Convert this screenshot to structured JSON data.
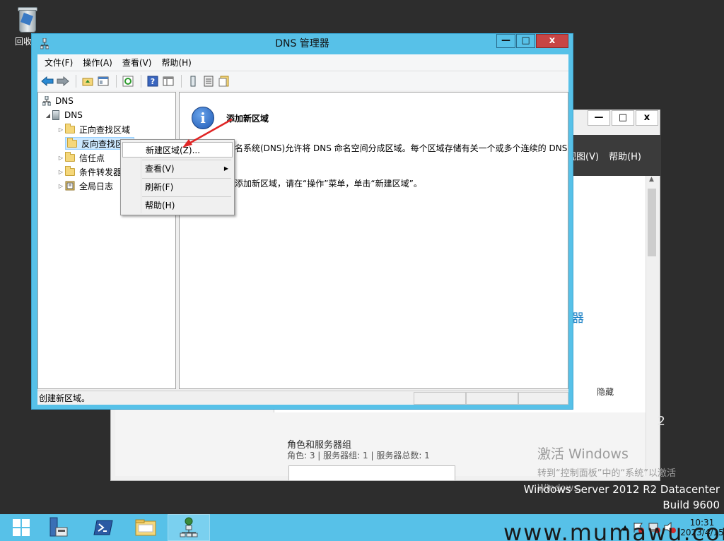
{
  "desktop": {
    "recycle_bin_label": "回收站",
    "server_edition": "Windows Server 2012 R2 Datacenter",
    "build": "Build 9600",
    "activation": {
      "title": "激活 Windows",
      "line1": "转到“控制面板”中的“系统”以激活",
      "line2": "Windows。"
    }
  },
  "server_manager": {
    "menu": [
      "视图(V)",
      "帮助(H)"
    ],
    "blue_fragment": "器",
    "hide_label": "隐藏",
    "roles_title": "角色和服务器组",
    "roles_subtitle": "角色: 3 | 服务器组: 1 | 服务器总数: 1",
    "q_fragment": "2",
    "controls": {
      "min": "—",
      "max": "□",
      "close": "x"
    }
  },
  "dns_window": {
    "title": "DNS 管理器",
    "controls": {
      "min": "—",
      "max": "□",
      "close": "x"
    },
    "menu": [
      "文件(F)",
      "操作(A)",
      "查看(V)",
      "帮助(H)"
    ],
    "tree": {
      "root": "DNS",
      "server": "DNS",
      "items": [
        "正向查找区域",
        "反向查找区域",
        "信任点",
        "条件转发器",
        "全局日志"
      ]
    },
    "info": {
      "title": "添加新区域",
      "text1": "域名系统(DNS)允许将 DNS 命名空间分成区域。每个区域存储有关一个或多个连续的 DNS",
      "text2": "要添加新区域，请在“操作”菜单，单击“新建区域”。"
    },
    "status": "创建新区域。"
  },
  "context_menu": {
    "items": [
      "新建区域(Z)...",
      "查看(V)",
      "刷新(F)",
      "帮助(H)"
    ]
  },
  "taskbar": {
    "time": "10:31",
    "date": "2023/4/15"
  },
  "watermark": "www.mumawu.com"
}
